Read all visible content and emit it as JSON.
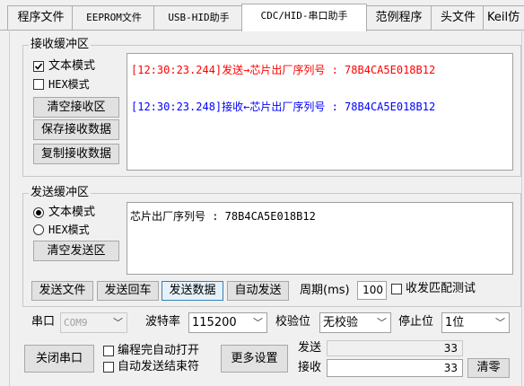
{
  "tabs": [
    {
      "label": "程序文件"
    },
    {
      "label": "EEPROM文件"
    },
    {
      "label": "USB-HID助手"
    },
    {
      "label": "CDC/HID-串口助手"
    },
    {
      "label": "范例程序"
    },
    {
      "label": "头文件"
    },
    {
      "label": "Keil仿"
    }
  ],
  "receive": {
    "legend": "接收缓冲区",
    "text_mode_label": "文本模式",
    "text_mode_checked": true,
    "hex_mode_label": "HEX模式",
    "hex_mode_checked": false,
    "clear_button": "清空接收区",
    "save_button": "保存接收数据",
    "copy_button": "复制接收数据",
    "lines": [
      {
        "text": "[12:30:23.244]发送→芯片出厂序列号 : 78B4CA5E018B12",
        "color": "#ff0000"
      },
      {
        "text": "[12:30:23.248]接收←芯片出厂序列号 : 78B4CA5E018B12",
        "color": "#0000ff"
      }
    ]
  },
  "send": {
    "legend": "发送缓冲区",
    "text_mode_label": "文本模式",
    "hex_mode_label": "HEX模式",
    "selected_mode": "text",
    "clear_button": "清空发送区",
    "content": "芯片出厂序列号 : 78B4CA5E018B12",
    "send_file_button": "发送文件",
    "send_enter_button": "发送回车",
    "send_data_button": "发送数据",
    "auto_send_button": "自动发送",
    "period_label": "周期(ms)",
    "period_value": "100",
    "match_test_label": "收发匹配测试",
    "match_test_checked": false
  },
  "port": {
    "port_label": "串口",
    "port_value": "COM9",
    "baud_label": "波特率",
    "baud_value": "115200",
    "parity_label": "校验位",
    "parity_value": "无校验",
    "stop_label": "停止位",
    "stop_value": "1位",
    "close_button": "关闭串口",
    "auto_open_label": "编程完自动打开",
    "auto_open_checked": false,
    "auto_end_label": "自动发送结束符",
    "auto_end_checked": false,
    "more_settings_button": "更多设置",
    "send_count_label": "发送",
    "send_count": "33",
    "recv_count_label": "接收",
    "recv_count": "33",
    "clear_count_button": "清零"
  },
  "colors": {
    "sent_text": "#ff0000",
    "received_text": "#0000ff",
    "window_bg": "#f0f0f0",
    "active_button_border": "#3c7fb1"
  }
}
